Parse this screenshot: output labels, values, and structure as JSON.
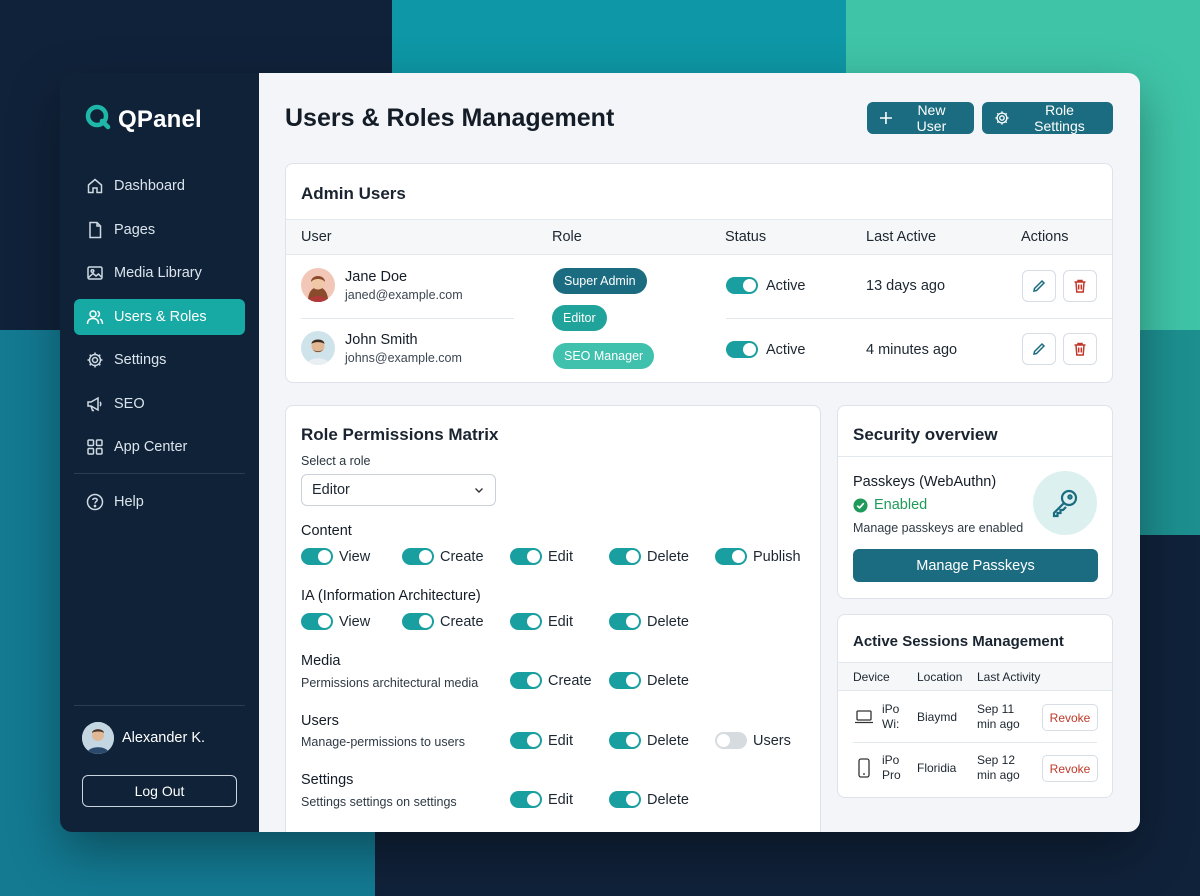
{
  "app": {
    "name": "QPanel"
  },
  "sidebar": {
    "items": [
      {
        "label": "Dashboard",
        "icon": "home-icon"
      },
      {
        "label": "Pages",
        "icon": "document-icon"
      },
      {
        "label": "Media Library",
        "icon": "image-icon"
      },
      {
        "label": "Users & Roles",
        "icon": "users-icon",
        "active": true
      },
      {
        "label": "Settings",
        "icon": "gear-icon"
      },
      {
        "label": "SEO",
        "icon": "megaphone-icon"
      },
      {
        "label": "App Center",
        "icon": "grid-icon"
      },
      {
        "label": "Help",
        "icon": "help-circle-icon"
      }
    ],
    "user_name": "Alexander K.",
    "logout_label": "Log Out"
  },
  "header": {
    "title": "Users & Roles Management",
    "new_user_label": "New User",
    "role_settings_label": "Role Settings"
  },
  "admin_users": {
    "title": "Admin Users",
    "columns": [
      "User",
      "Role",
      "Status",
      "Last Active",
      "Actions"
    ],
    "rows": [
      {
        "name": "Jane Doe",
        "email": "janed@example.com",
        "status": "Active",
        "last_active": "13 days ago"
      },
      {
        "name": "John Smith",
        "email": "johns@example.com",
        "status": "Active",
        "last_active": "4 minutes ago"
      }
    ],
    "roles": [
      "Super Admin",
      "Editor",
      "SEO Manager"
    ]
  },
  "permissions": {
    "title": "Role Permissions Matrix",
    "select_label": "Select a role",
    "selected_role": "Editor",
    "sections": [
      {
        "title": "Content",
        "desc": "",
        "perms": [
          {
            "label": "View",
            "on": true
          },
          {
            "label": "Create",
            "on": true
          },
          {
            "label": "Edit",
            "on": true
          },
          {
            "label": "Delete",
            "on": true
          },
          {
            "label": "Publish",
            "on": true
          }
        ]
      },
      {
        "title": "IA (Information Architecture)",
        "desc": "",
        "perms": [
          {
            "label": "View",
            "on": true
          },
          {
            "label": "Create",
            "on": true
          },
          {
            "label": "Edit",
            "on": true
          },
          {
            "label": "Delete",
            "on": true
          }
        ]
      },
      {
        "title": "Media",
        "desc": "Permissions architectural media",
        "perms": [
          {
            "label": "Create",
            "on": true
          },
          {
            "label": "Delete",
            "on": true
          }
        ]
      },
      {
        "title": "Users",
        "desc": "Manage-permissions to users",
        "perms": [
          {
            "label": "Edit",
            "on": true
          },
          {
            "label": "Delete",
            "on": true
          },
          {
            "label": "Users",
            "on": false
          }
        ]
      },
      {
        "title": "Settings",
        "desc": "Settings settings on settings",
        "perms": [
          {
            "label": "Edit",
            "on": true
          },
          {
            "label": "Delete",
            "on": true
          }
        ]
      }
    ]
  },
  "security": {
    "title": "Security overview",
    "passkeys_title": "Passkeys (WebAuthn)",
    "passkeys_status": "Enabled",
    "passkeys_desc": "Manage passkeys are enabled",
    "manage_label": "Manage Passkeys"
  },
  "sessions": {
    "title": "Active Sessions Management",
    "columns": [
      "Device",
      "Location",
      "Last Activity"
    ],
    "rows": [
      {
        "device_line1": "iPo",
        "device_line2": "Wi:",
        "location": "Biaymd",
        "activity_line1": "Sep 11",
        "activity_line2": "min ago",
        "action": "Revoke",
        "icon": "laptop-icon"
      },
      {
        "device_line1": "iPo",
        "device_line2": "Pro",
        "location": "Floridia",
        "activity_line1": "Sep 12",
        "activity_line2": "min ago",
        "action": "Revoke",
        "icon": "phone-icon"
      }
    ]
  },
  "colors": {
    "accent": "#17a9a3",
    "primary_button": "#1b6c80",
    "sidebar_bg": "#0f2238",
    "success": "#1f9a5b",
    "danger": "#c0392b"
  }
}
